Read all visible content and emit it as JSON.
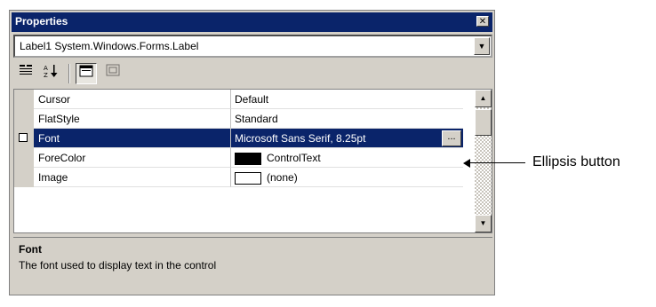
{
  "window": {
    "title": "Properties"
  },
  "object_selector": {
    "value": "Label1  System.Windows.Forms.Label"
  },
  "toolbar": {
    "categorized_icon": "categorized-icon",
    "alphabetical_icon": "alphabetical-icon",
    "properties_icon": "properties-icon",
    "events_icon": "events-icon"
  },
  "grid": {
    "rows": [
      {
        "name": "Cursor",
        "value": "Default"
      },
      {
        "name": "FlatStyle",
        "value": "Standard"
      },
      {
        "name": "Font",
        "value": "Microsoft Sans Serif, 8.25pt"
      },
      {
        "name": "ForeColor",
        "value": "ControlText",
        "swatch": "#000000"
      },
      {
        "name": "Image",
        "value": "(none)",
        "swatch": "#ffffff"
      }
    ],
    "ellipsis_label": "...",
    "selected_row": "Font"
  },
  "description": {
    "title": "Font",
    "text": "The font used to display text in the control"
  },
  "annotation": {
    "label": "Ellipsis button"
  },
  "colors": {
    "titlebar": "#0a246a",
    "selection": "#0a246a",
    "panel": "#d4d0c8"
  }
}
